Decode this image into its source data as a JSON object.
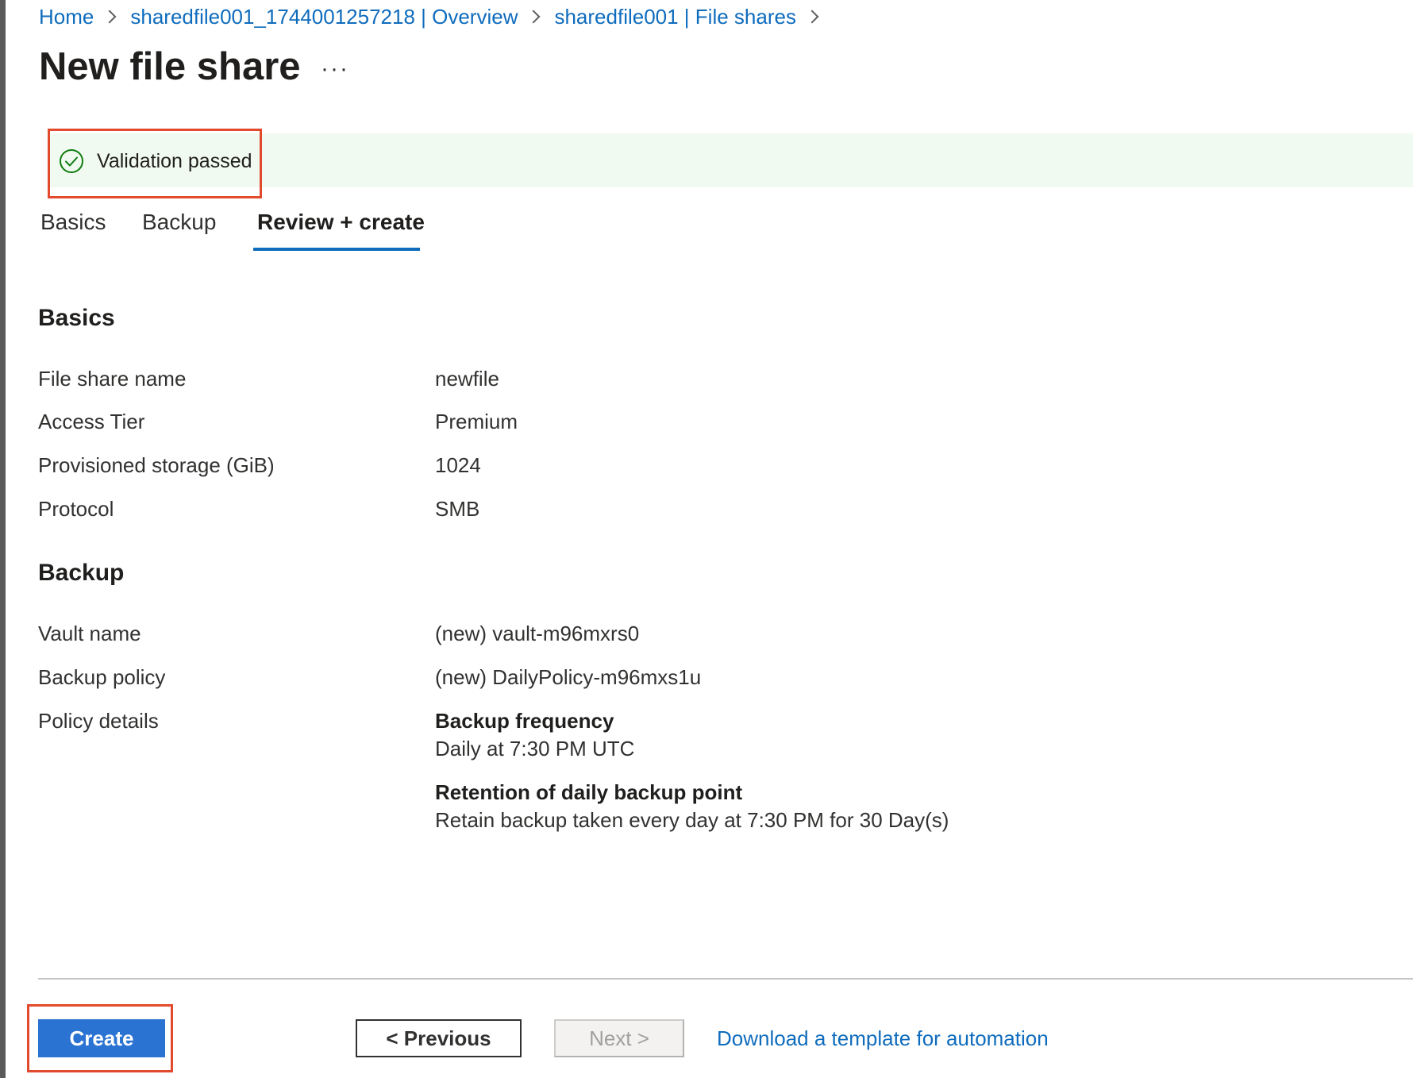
{
  "breadcrumb": {
    "items": [
      "Home",
      "sharedfile001_1744001257218 | Overview",
      "sharedfile001 | File shares"
    ]
  },
  "page": {
    "title": "New file share",
    "more_label": "···"
  },
  "validation": {
    "text": "Validation passed",
    "status_color": "#107c10",
    "icon": "check-circle-icon"
  },
  "tabs": [
    {
      "label": "Basics",
      "active": false
    },
    {
      "label": "Backup",
      "active": false
    },
    {
      "label": "Review + create",
      "active": true
    }
  ],
  "basics": {
    "heading": "Basics",
    "rows": [
      {
        "label": "File share name",
        "value": "newfile"
      },
      {
        "label": "Access Tier",
        "value": "Premium"
      },
      {
        "label": "Provisioned storage (GiB)",
        "value": "1024"
      },
      {
        "label": "Protocol",
        "value": "SMB"
      }
    ]
  },
  "backup": {
    "heading": "Backup",
    "rows": [
      {
        "label": "Vault name",
        "value": "(new) vault-m96mxrs0"
      },
      {
        "label": "Backup policy",
        "value": "(new) DailyPolicy-m96mxs1u"
      }
    ],
    "policy_details": {
      "label": "Policy details",
      "frequency_title": "Backup frequency",
      "frequency_value": "Daily at 7:30 PM UTC",
      "retention_title": "Retention of daily backup point",
      "retention_value": "Retain backup taken every day at 7:30 PM for 30 Day(s)"
    }
  },
  "footer": {
    "create_label": "Create",
    "previous_label": "< Previous",
    "next_label": "Next >",
    "download_label": "Download a template for automation"
  },
  "colors": {
    "accent": "#0f6cbd",
    "primary_button": "#2a73d2",
    "highlight": "#e14a2c",
    "banner_bg": "#f1faf0"
  }
}
